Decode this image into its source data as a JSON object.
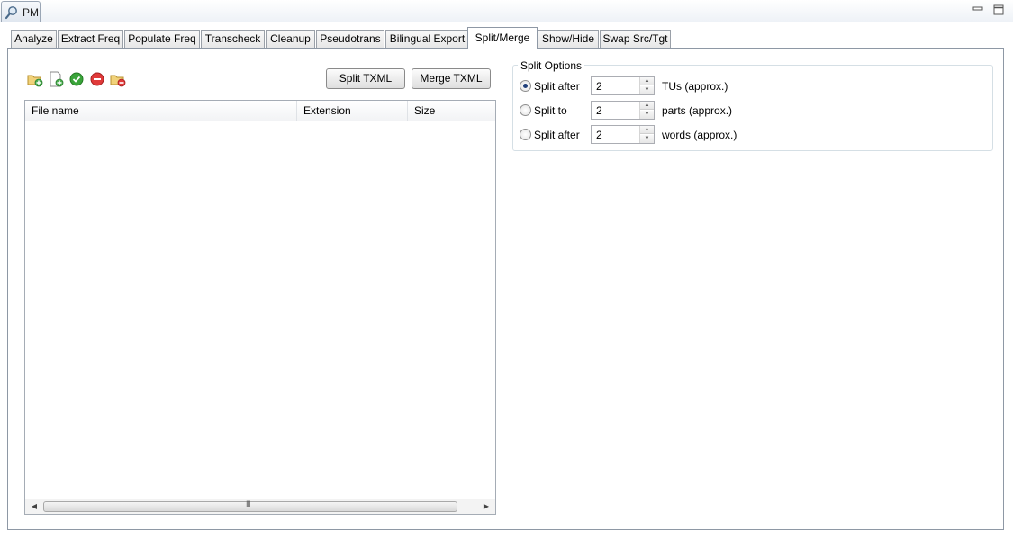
{
  "view": {
    "title": "PM"
  },
  "tabs": [
    {
      "label": "Analyze"
    },
    {
      "label": "Extract Freq"
    },
    {
      "label": "Populate Freq"
    },
    {
      "label": "Transcheck"
    },
    {
      "label": "Cleanup"
    },
    {
      "label": "Pseudotrans"
    },
    {
      "label": "Bilingual Export"
    },
    {
      "label": "Split/Merge",
      "active": true
    },
    {
      "label": "Show/Hide"
    },
    {
      "label": "Swap Src/Tgt"
    }
  ],
  "toolbar": {
    "icons": [
      "add-folder-icon",
      "add-file-icon",
      "check-icon",
      "remove-icon",
      "remove-folder-icon"
    ],
    "split_label": "Split TXML",
    "merge_label": "Merge TXML"
  },
  "file_table": {
    "columns": [
      "File name",
      "Extension",
      "Size"
    ],
    "rows": [],
    "scroll_grip": "III"
  },
  "split_options": {
    "title": "Split Options",
    "options": [
      {
        "label": "Split after",
        "value": "2",
        "unit": "TUs (approx.)",
        "checked": true
      },
      {
        "label": "Split to",
        "value": "2",
        "unit": "parts (approx.)",
        "checked": false
      },
      {
        "label": "Split after",
        "value": "2",
        "unit": "words (approx.)",
        "checked": false
      }
    ]
  },
  "colors": {
    "accent": "#1f3f7a",
    "check": "#3aa43a",
    "remove": "#e03a3a",
    "folder": "#e8c35a"
  }
}
